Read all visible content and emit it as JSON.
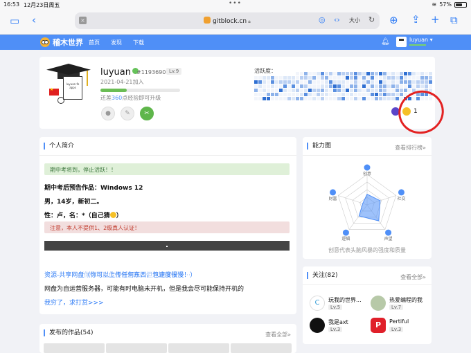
{
  "status_bar": {
    "time": "16:53",
    "date": "12月23日周五",
    "battery": "57%"
  },
  "browser": {
    "url": "gitblock.cn",
    "zoom_label": "大小"
  },
  "site_nav": {
    "brand": "稽木世界",
    "links": [
      "首页",
      "发现",
      "下载"
    ],
    "user": "luyuan"
  },
  "profile": {
    "name": "luyuan",
    "id": "#1193690",
    "level": "Lv.9",
    "joined": "2021-04-21加入",
    "xp_progress": 0.33,
    "xp_prefix": "还差",
    "xp_value": "360",
    "xp_suffix": "点经验即可升级",
    "activity_label": "活跃度：",
    "badge_count": "1",
    "avatar_board_text": "luyuan fe apps"
  },
  "intro": {
    "title": "个人简介",
    "notice_green": "期中考将到，停止活跃！！",
    "line1": "期中考后预告作品：Windows 12",
    "line2": "男，14岁，新初二。",
    "line3": "性：卢，名：*（自己猜",
    "line3_end": "）",
    "notice_red": "注意，本人不提供1、2级真人认证！",
    "link_text": "资源-共享网盘（你可以上传任何东西，包速度很慢！）",
    "link_ghost": "（你可以上传任何东西，但速度很慢）·····",
    "line4": "网盘为自运营服务器，可能有时电脑未开机，但是我会尽可能保持开机的",
    "link2": "我穷了，求打赏>>>"
  },
  "ability": {
    "title": "能力图",
    "more": "查看排行榜»",
    "axes": [
      "创意",
      "社交",
      "声望",
      "逻辑",
      "财富"
    ],
    "values": [
      0.35,
      0.45,
      0.65,
      0.45,
      0.15
    ],
    "caption": "创意代表头脑风暴的强度和质量"
  },
  "follow": {
    "title": "关注(82)",
    "more": "查看全部»",
    "items": [
      {
        "name": "玩我的世界...",
        "level": "Lv.5",
        "avatar_letter": "C"
      },
      {
        "name": "热爱编程的我",
        "level": "Lv.7",
        "avatar_letter": ""
      },
      {
        "name": "我是axt",
        "level": "Lv.3",
        "avatar_letter": ""
      },
      {
        "name": "Pertiful",
        "level": "Lv.3",
        "avatar_letter": "P"
      }
    ]
  },
  "works": {
    "title": "发布的作品(54)",
    "more": "查看全部»"
  },
  "colors": {
    "brand_blue": "#4f8ff7",
    "green": "#5fb64b",
    "annotation_red": "#e32222"
  }
}
